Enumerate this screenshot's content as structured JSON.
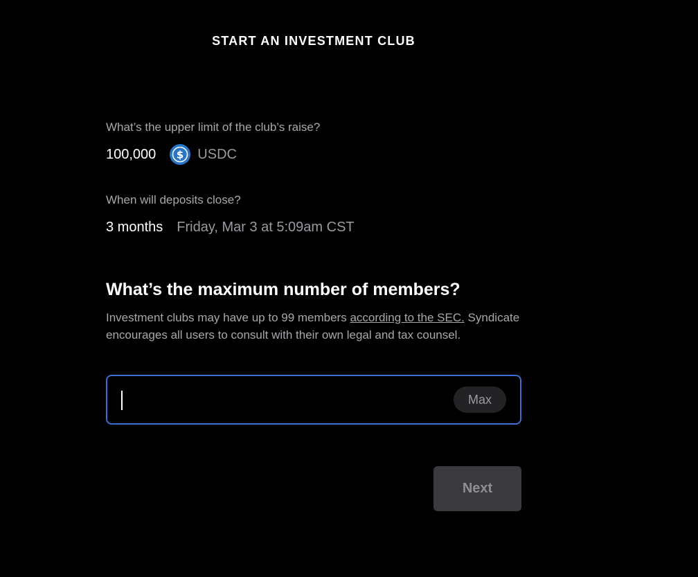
{
  "header": {
    "title": "START AN INVESTMENT CLUB"
  },
  "raise": {
    "question": "What’s the upper limit of the club’s raise?",
    "amount": "100,000",
    "token_icon": "usdc-coin-icon",
    "token": "USDC",
    "token_color": "#2775ca"
  },
  "deposits": {
    "question": "When will deposits close?",
    "duration": "3 months",
    "close_date": "Friday, Mar 3 at 5:09am CST"
  },
  "members": {
    "question": "What’s the maximum number of members?",
    "help_prefix": "Investment clubs may have up to 99 members ",
    "help_link": "according to the SEC.",
    "help_suffix": " Syndicate encourages all users to consult with their own legal and tax counsel.",
    "input_value": "",
    "input_placeholder": "",
    "max_label": "Max",
    "focus_color": "#3b6fd6"
  },
  "footer": {
    "next_label": "Next"
  }
}
